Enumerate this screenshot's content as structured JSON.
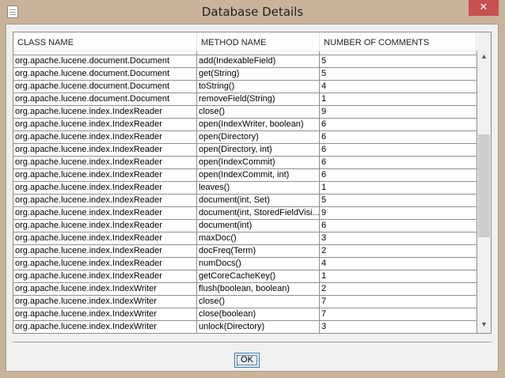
{
  "window": {
    "title": "Database Details",
    "close": "✕"
  },
  "table": {
    "headers": [
      "CLASS NAME",
      "METHOD NAME",
      "NUMBER OF COMMENTS"
    ],
    "rows": [
      [
        "org.apache.lucene.document.Document",
        "add(IndexableField)",
        "5"
      ],
      [
        "org.apache.lucene.document.Document",
        "get(String)",
        "5"
      ],
      [
        "org.apache.lucene.document.Document",
        "toString()",
        "4"
      ],
      [
        "org.apache.lucene.document.Document",
        "removeField(String)",
        "1"
      ],
      [
        "org.apache.lucene.index.IndexReader",
        "close()",
        "9"
      ],
      [
        "org.apache.lucene.index.IndexReader",
        "open(IndexWriter, boolean)",
        "6"
      ],
      [
        "org.apache.lucene.index.IndexReader",
        "open(Directory)",
        "6"
      ],
      [
        "org.apache.lucene.index.IndexReader",
        "open(Directory, int)",
        "6"
      ],
      [
        "org.apache.lucene.index.IndexReader",
        "open(IndexCommit)",
        "6"
      ],
      [
        "org.apache.lucene.index.IndexReader",
        "open(IndexCommit, int)",
        "6"
      ],
      [
        "org.apache.lucene.index.IndexReader",
        "leaves()",
        "1"
      ],
      [
        "org.apache.lucene.index.IndexReader",
        "document(int, Set)",
        "5"
      ],
      [
        "org.apache.lucene.index.IndexReader",
        "document(int, StoredFieldVisi...",
        "9"
      ],
      [
        "org.apache.lucene.index.IndexReader",
        "document(int)",
        "6"
      ],
      [
        "org.apache.lucene.index.IndexReader",
        "maxDoc()",
        "3"
      ],
      [
        "org.apache.lucene.index.IndexReader",
        "docFreq(Term)",
        "2"
      ],
      [
        "org.apache.lucene.index.IndexReader",
        "numDocs()",
        "4"
      ],
      [
        "org.apache.lucene.index.IndexReader",
        "getCoreCacheKey()",
        "1"
      ],
      [
        "org.apache.lucene.index.IndexWriter",
        "flush(boolean, boolean)",
        "2"
      ],
      [
        "org.apache.lucene.index.IndexWriter",
        "close()",
        "7"
      ],
      [
        "org.apache.lucene.index.IndexWriter",
        "close(boolean)",
        "7"
      ],
      [
        "org.apache.lucene.index.IndexWriter",
        "unlock(Directory)",
        "3"
      ]
    ]
  },
  "buttons": {
    "ok": "OK"
  }
}
